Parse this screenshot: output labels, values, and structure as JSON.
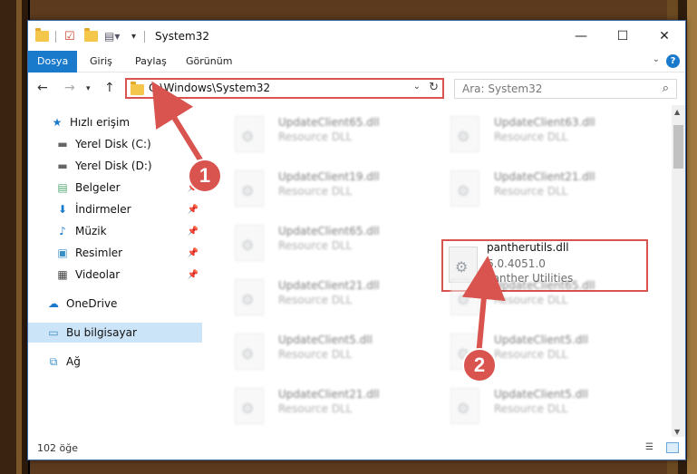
{
  "window": {
    "title": "System32",
    "controls": {
      "minimize": "—",
      "maximize": "☐",
      "close": "✕"
    }
  },
  "ribbon": {
    "tabs": [
      "Dosya",
      "Giriş",
      "Paylaş",
      "Görünüm"
    ],
    "help": "?",
    "collapse": "⌄"
  },
  "address": {
    "path": "C:\\Windows\\System32",
    "search_placeholder": "Ara: System32"
  },
  "sidebar": {
    "items": [
      {
        "label": "Hızlı erişim",
        "icon": "star-icon"
      },
      {
        "label": "Yerel Disk (C:)",
        "icon": "drive-icon"
      },
      {
        "label": "Yerel Disk (D:)",
        "icon": "drive-icon"
      },
      {
        "label": "Belgeler",
        "icon": "documents-icon"
      },
      {
        "label": "İndirmeler",
        "icon": "downloads-icon"
      },
      {
        "label": "Müzik",
        "icon": "music-icon"
      },
      {
        "label": "Resimler",
        "icon": "pictures-icon"
      },
      {
        "label": "Videolar",
        "icon": "videos-icon"
      },
      {
        "label": "OneDrive",
        "icon": "cloud-icon"
      },
      {
        "label": "Bu bilgisayar",
        "icon": "computer-icon"
      },
      {
        "label": "Ağ",
        "icon": "network-icon"
      }
    ]
  },
  "files": [
    {
      "name": "UpdateClient65.dll",
      "desc": "Resource DLL"
    },
    {
      "name": "UpdateClient63.dll",
      "desc": "Resource DLL"
    },
    {
      "name": "UpdateClient19.dll",
      "desc": "Resource DLL"
    },
    {
      "name": "UpdateClient21.dll",
      "desc": "Resource DLL"
    },
    {
      "name": "UpdateClient65.dll",
      "desc": "Resource DLL"
    },
    {
      "name": "pantherutils.dll",
      "version": "6.0.4051.0",
      "desc": "Panther Utilities"
    },
    {
      "name": "UpdateClient21.dll",
      "desc": "Resource DLL"
    },
    {
      "name": "UpdateClient65.dll",
      "desc": "Resource DLL"
    },
    {
      "name": "UpdateClient5.dll",
      "desc": "Resource DLL"
    },
    {
      "name": "UpdateClient5.dll",
      "desc": "Resource DLL"
    },
    {
      "name": "UpdateClient21.dll",
      "desc": "Resource DLL"
    },
    {
      "name": "UpdateClient5.dll",
      "desc": "Resource DLL"
    }
  ],
  "status": {
    "count": "102 öğe"
  },
  "markers": [
    "1",
    "2"
  ],
  "colors": {
    "accent": "#1979ca",
    "highlight": "#d9534f",
    "selected": "#cce4f7"
  }
}
